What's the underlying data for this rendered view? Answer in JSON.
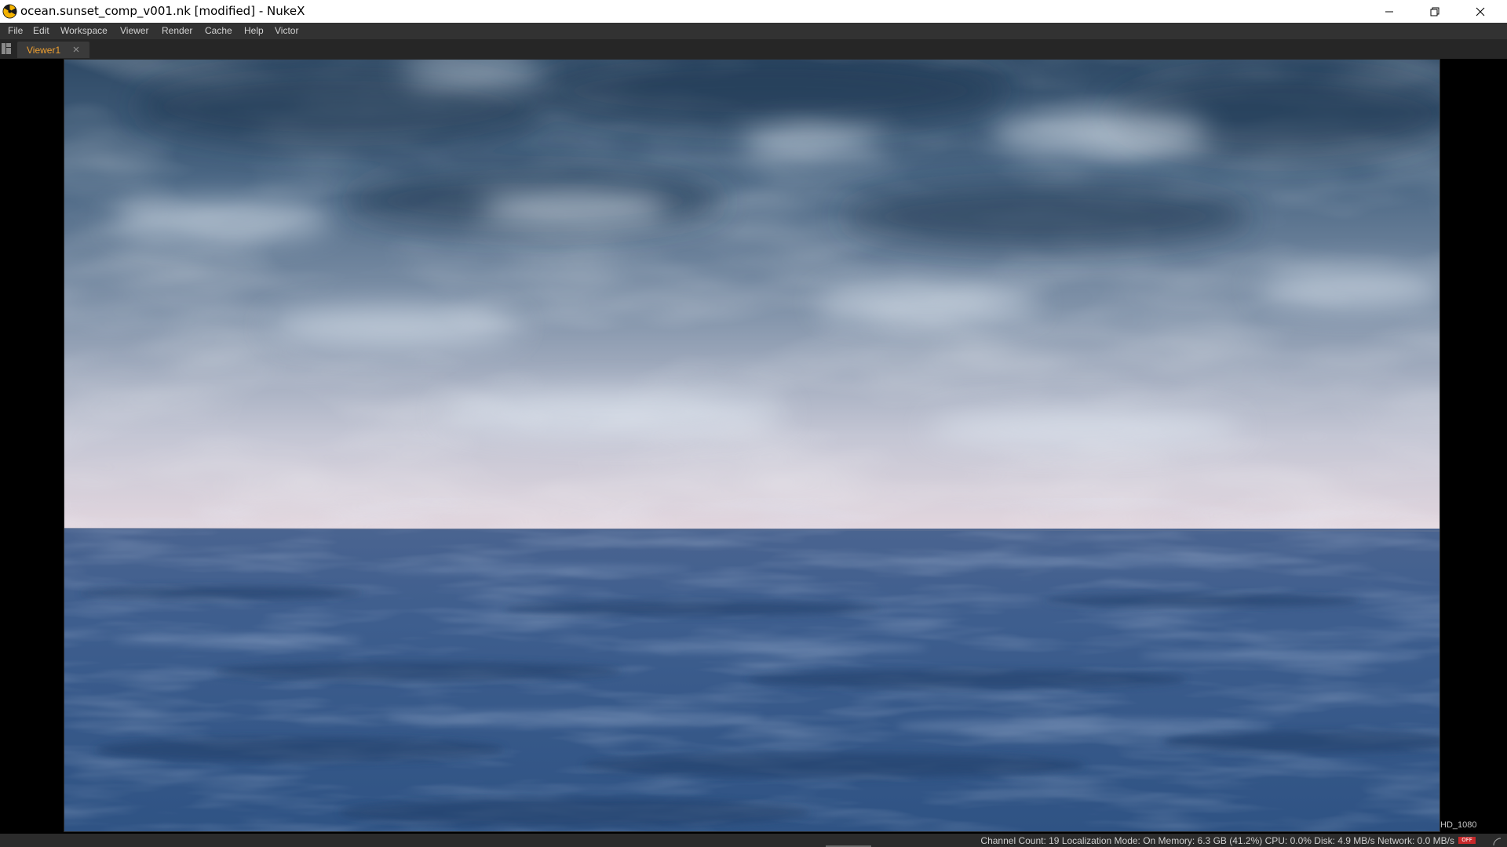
{
  "window": {
    "title": "ocean.sunset_comp_v001.nk [modified] - NukeX",
    "app_icon": "nukex-radiation-icon",
    "controls": [
      "minimize-icon",
      "restore-icon",
      "close-icon"
    ]
  },
  "menubar": {
    "items": [
      "File",
      "Edit",
      "Workspace",
      "Viewer",
      "Render",
      "Cache",
      "Help",
      "Victor"
    ]
  },
  "tabs": {
    "panel_menu_icon": "panel-menu-icon",
    "items": [
      {
        "label": "Viewer1",
        "active": true,
        "close_icon": "close-icon"
      }
    ],
    "active_color": "#f0a030"
  },
  "viewer": {
    "format": "HD_1080",
    "image_description_colors": {
      "sky_top": "#3f5a76",
      "horizon": "#dccfd8",
      "sea": "#3b5d8c"
    }
  },
  "status": {
    "text": "Channel Count: 19  Localization Mode: On  Memory: 6.3 GB (41.2%)  CPU: 0.0%  Disk: 4.9 MB/s  Network: 0.0 MB/s",
    "badge": "OFF",
    "badge_color": "#c8282a"
  }
}
